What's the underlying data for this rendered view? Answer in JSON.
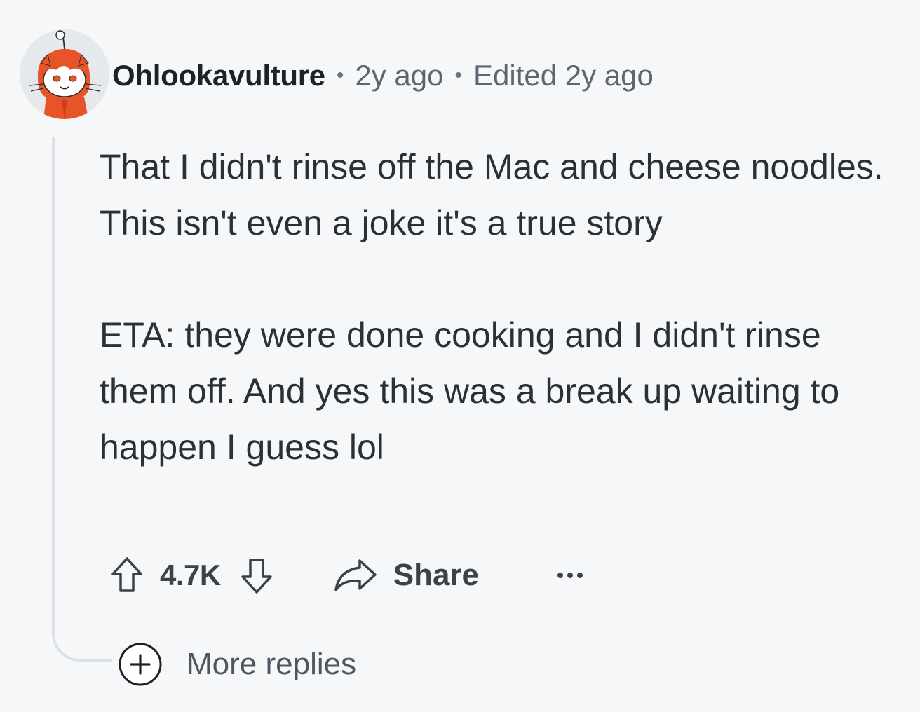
{
  "comment": {
    "username": "Ohlookavulture",
    "posted": "2y ago",
    "edited": "Edited 2y ago",
    "separator": "•",
    "body": [
      "That I didn't rinse off the Mac and cheese noodles. This isn't even a joke it's a true story",
      "ETA: they were done cooking and I didn't rinse them off. And yes this was a break up waiting to happen I guess lol"
    ],
    "votes": "4.7K",
    "share_label": "Share"
  },
  "more_replies_label": "More replies",
  "icons": {
    "avatar": "snoo-avatar",
    "upvote": "arrow-up-icon",
    "downvote": "arrow-down-icon",
    "share": "share-arrow-icon",
    "more": "ellipsis-icon",
    "expand": "plus-circle-icon"
  },
  "colors": {
    "background": "#f6f7f9",
    "thread_line": "#dde1e5",
    "text": "#2a3136",
    "avatar_accent": "#e8542a"
  }
}
